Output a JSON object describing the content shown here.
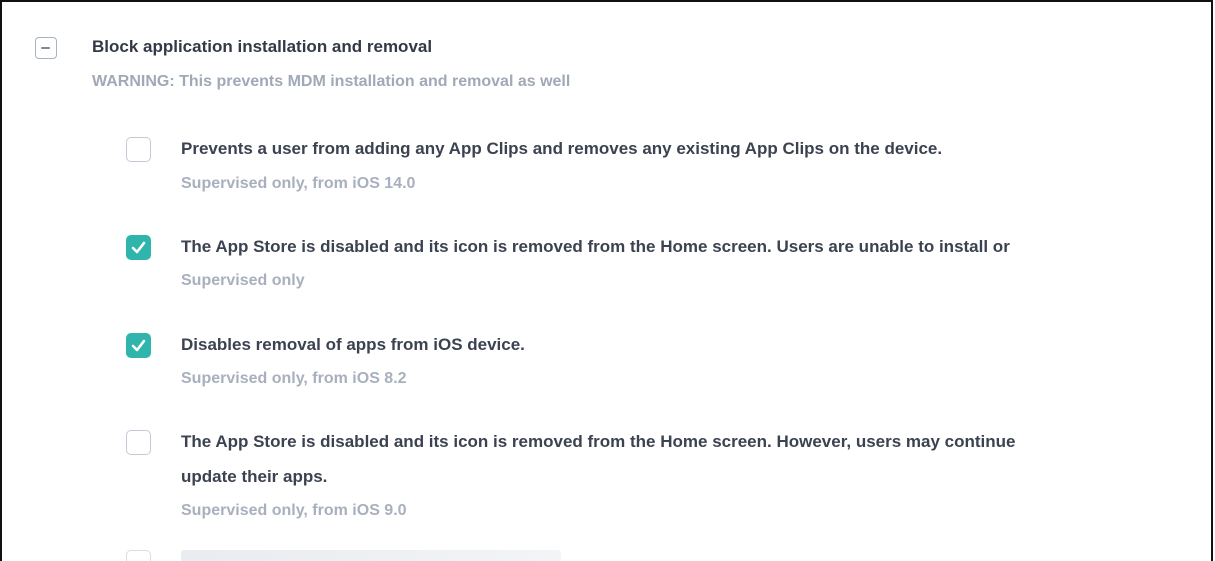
{
  "parent": {
    "title": "Block application installation and removal",
    "warning": "WARNING: This prevents MDM installation and removal as well",
    "toggle_icon": "minus-icon",
    "state": "indeterminate"
  },
  "options": [
    {
      "checked": false,
      "text": "Prevents a user from adding any App Clips and removes any existing App Clips on the device.",
      "sub": "Supervised only, from iOS 14.0"
    },
    {
      "checked": true,
      "text": "The App Store is disabled and its icon is removed from the Home screen. Users are unable to install or",
      "sub": "Supervised only"
    },
    {
      "checked": true,
      "text": "Disables removal of apps from iOS device.",
      "sub": "Supervised only, from iOS 8.2"
    },
    {
      "checked": false,
      "text": "The App Store is disabled and its icon is removed from the Home screen. However, users may continue",
      "text2": "update their apps.",
      "sub": "Supervised only, from iOS 9.0"
    }
  ],
  "colors": {
    "checked": "#2fb5ab",
    "title": "#333a46",
    "muted": "#a8b0bd"
  }
}
